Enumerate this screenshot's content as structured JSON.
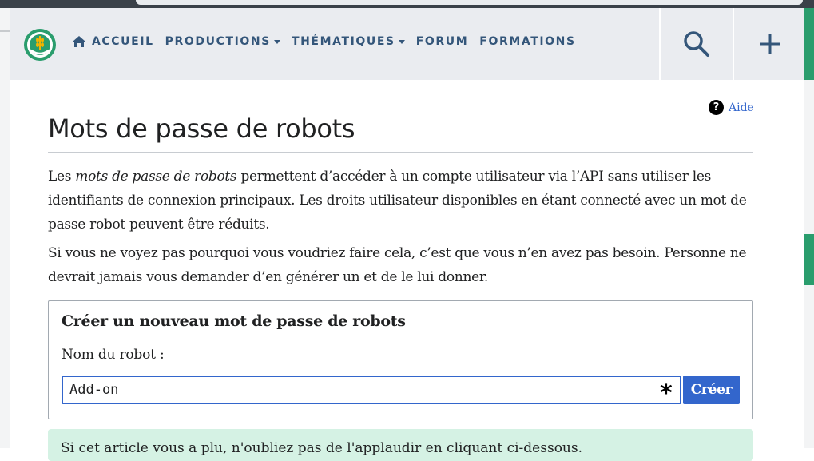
{
  "nav": {
    "logo_icon": "site-logo",
    "home_icon": "home-icon",
    "links": [
      {
        "label": "ACCUEIL",
        "has_dropdown": false
      },
      {
        "label": "PRODUCTIONS",
        "has_dropdown": true
      },
      {
        "label": "THÉMATIQUES",
        "has_dropdown": true
      },
      {
        "label": "FORUM",
        "has_dropdown": false
      },
      {
        "label": "FORMATIONS",
        "has_dropdown": false
      }
    ],
    "search_icon": "search-icon",
    "add_icon": "plus-icon"
  },
  "help": {
    "label": "Aide",
    "icon": "question-circle-icon"
  },
  "page": {
    "title": "Mots de passe de robots",
    "p1_before": "Les ",
    "p1_em": "mots de passe de robots",
    "p1_after": " permettent d’accéder à un compte utilisateur via l’API sans utiliser les identifiants de connexion principaux. Les droits utilisateur disponibles en étant connecté avec un mot de passe robot peuvent être réduits.",
    "p2": "Si vous ne voyez pas pourquoi vous voudriez faire cela, c’est que vous n’en avez pas besoin. Personne ne devrait jamais vous demander d’en générer un et de le lui donner."
  },
  "form": {
    "title": "Créer un nouveau mot de passe de robots",
    "label": "Nom du robot :",
    "input_value": "Add-on",
    "submit_label": "Créer"
  },
  "notice": {
    "text": "Si cet article vous a plu, n'oubliez pas de l'applaudir en cliquant ci-dessous."
  },
  "colors": {
    "accent": "#3366cc",
    "nav_text": "#34567a",
    "brand_green": "#2a9d6d",
    "notice_bg": "#d5f2e4"
  }
}
